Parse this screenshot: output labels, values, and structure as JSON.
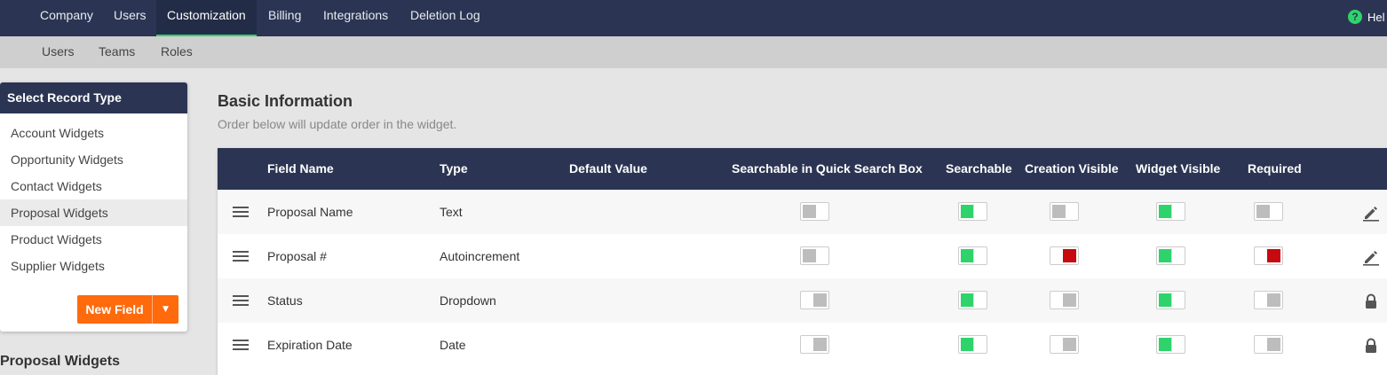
{
  "topnav": {
    "tabs": [
      {
        "label": "Company",
        "active": false
      },
      {
        "label": "Users",
        "active": false
      },
      {
        "label": "Customization",
        "active": true
      },
      {
        "label": "Billing",
        "active": false
      },
      {
        "label": "Integrations",
        "active": false
      },
      {
        "label": "Deletion Log",
        "active": false
      }
    ],
    "help_label": "Hel",
    "help_icon": "question-circle-icon"
  },
  "subnav": {
    "tabs": [
      {
        "label": "Users"
      },
      {
        "label": "Teams"
      },
      {
        "label": "Roles"
      }
    ]
  },
  "sidebar": {
    "title": "Select Record Type",
    "items": [
      {
        "label": "Account Widgets",
        "selected": false
      },
      {
        "label": "Opportunity Widgets",
        "selected": false
      },
      {
        "label": "Contact Widgets",
        "selected": false
      },
      {
        "label": "Proposal Widgets",
        "selected": true
      },
      {
        "label": "Product Widgets",
        "selected": false
      },
      {
        "label": "Supplier Widgets",
        "selected": false
      }
    ],
    "new_button": "New Field",
    "caret": "▼"
  },
  "section_label": "Proposal Widgets",
  "main": {
    "title": "Basic Information",
    "subtitle": "Order below will update order in the widget."
  },
  "table": {
    "headers": {
      "field_name": "Field Name",
      "type": "Type",
      "default_value": "Default Value",
      "quick_search": "Searchable in Quick Search Box",
      "searchable": "Searchable",
      "creation_visible": "Creation Visible",
      "widget_visible": "Widget Visible",
      "required": "Required"
    },
    "rows": [
      {
        "name": "Proposal Name",
        "type": "Text",
        "default": "",
        "quick": "off-l",
        "searchable": "on",
        "creation": "off-l",
        "widget": "on",
        "required": "off-l",
        "action": "pencil-icon"
      },
      {
        "name": "Proposal #",
        "type": "Autoincrement",
        "default": "",
        "quick": "off-l",
        "searchable": "on",
        "creation": "red",
        "widget": "on",
        "required": "red",
        "action": "pencil-icon"
      },
      {
        "name": "Status",
        "type": "Dropdown",
        "default": "",
        "quick": "off-r",
        "searchable": "on",
        "creation": "off-r",
        "widget": "on",
        "required": "off-r",
        "action": "lock-icon"
      },
      {
        "name": "Expiration Date",
        "type": "Date",
        "default": "",
        "quick": "off-r",
        "searchable": "on",
        "creation": "off-r",
        "widget": "on",
        "required": "off-r",
        "action": "lock-icon"
      }
    ]
  },
  "colors": {
    "navy": "#2b3553",
    "accent_green": "#2fd36b",
    "toggle_red": "#c8090f",
    "toggle_gray": "#bdbdbd",
    "button_orange": "#ff6a0d"
  }
}
